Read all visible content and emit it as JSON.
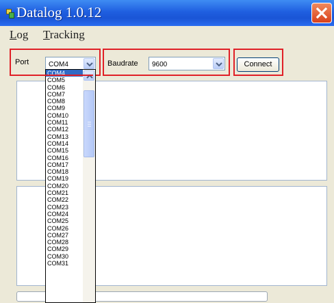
{
  "window": {
    "title": "Datalog 1.0.12",
    "icon": "app-icon",
    "close_icon": "close-icon"
  },
  "menu": {
    "items": [
      {
        "label": "Log",
        "underline": "L",
        "rest": "og"
      },
      {
        "label": "Tracking",
        "underline": "T",
        "rest": "racking"
      }
    ]
  },
  "connection": {
    "port_label": "Port",
    "port_value": "COM4",
    "baudrate_label": "Baudrate",
    "baudrate_value": "9600",
    "connect_label": "Connect"
  },
  "port_dropdown": {
    "selected": "COM4",
    "options": [
      "COM4",
      "COM5",
      "COM6",
      "COM7",
      "COM8",
      "COM9",
      "COM10",
      "COM11",
      "COM12",
      "COM13",
      "COM14",
      "COM15",
      "COM16",
      "COM17",
      "COM18",
      "COM19",
      "COM20",
      "COM21",
      "COM22",
      "COM23",
      "COM24",
      "COM25",
      "COM26",
      "COM27",
      "COM28",
      "COM29",
      "COM30",
      "COM31"
    ]
  },
  "colors": {
    "highlight_red": "#e01f26",
    "titlebar_blue": "#1f5fe0",
    "selection_blue": "#316ac5"
  }
}
